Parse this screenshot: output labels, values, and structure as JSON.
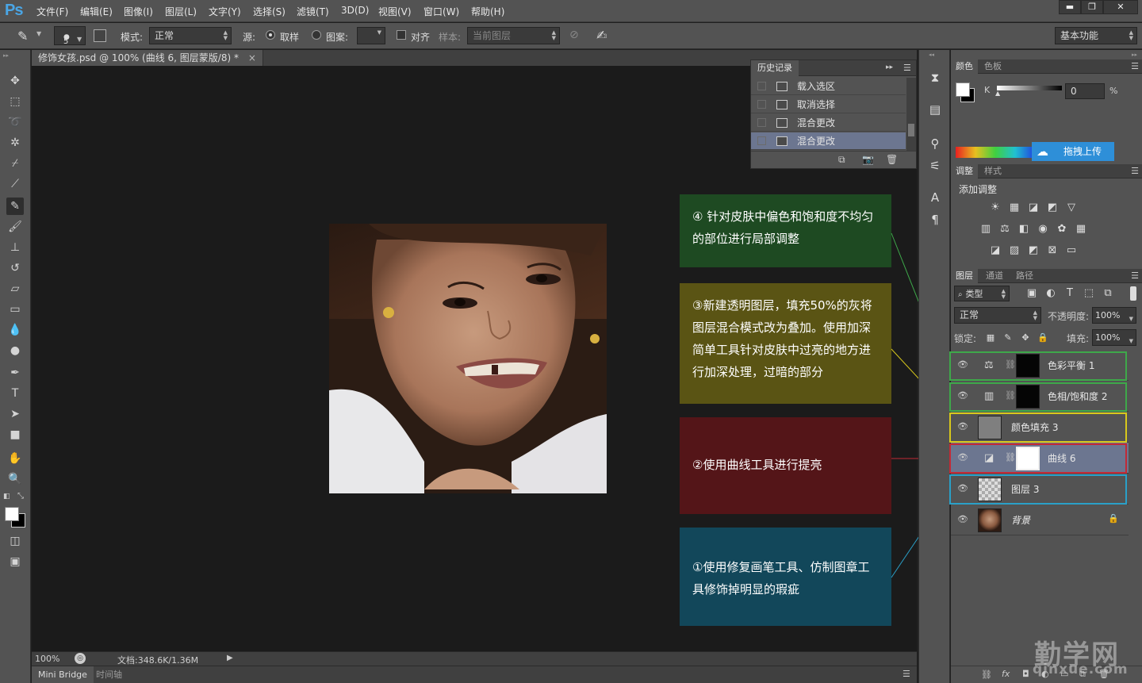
{
  "app": {
    "logo": "Ps"
  },
  "menu": [
    "文件(F)",
    "编辑(E)",
    "图像(I)",
    "图层(L)",
    "文字(Y)",
    "选择(S)",
    "滤镜(T)",
    "3D(D)",
    "视图(V)",
    "窗口(W)",
    "帮助(H)"
  ],
  "window_controls": {
    "minimize": "▬",
    "restore": "❐",
    "close": "✕"
  },
  "options": {
    "brush_size": "5",
    "mode_label": "模式:",
    "mode_value": "正常",
    "source_label": "源:",
    "sampled_label": "取样",
    "pattern_label": "图案:",
    "aligned_label": "对齐",
    "sample_label": "样本:",
    "sample_value": "当前图层",
    "workspace": "基本功能"
  },
  "document": {
    "tab_title": "修饰女孩.psd @ 100% (曲线 6, 图层蒙版/8) *",
    "tab_close": "×",
    "zoom": "100%",
    "doc_info": "文档:348.6K/1.36M"
  },
  "bottom_tabs": [
    "Mini Bridge",
    "时间轴"
  ],
  "history": {
    "title": "历史记录",
    "items": [
      "载入选区",
      "取消选择",
      "混合更改",
      "混合更改"
    ],
    "selected_index": 3
  },
  "notes": [
    {
      "text": "④ 针对皮肤中偏色和饱和度不均匀的部位进行局部调整",
      "color": "#1e4a22"
    },
    {
      "text": "③新建透明图层，填充50%的灰将图层混合模式改为叠加。使用加深简单工具针对皮肤中过亮的地方进行加深处理，过暗的部分",
      "color": "#5a5414"
    },
    {
      "text": "②使用曲线工具进行提亮",
      "color": "#541518"
    },
    {
      "text": "①使用修复画笔工具、仿制图章工具修饰掉明显的瑕疵",
      "color": "#12475a"
    }
  ],
  "color_panel": {
    "tabs": [
      "颜色",
      "色板"
    ],
    "channel_label": "K",
    "k_value": "0",
    "unit": "%",
    "upload_label": "拖拽上传"
  },
  "adjust_panel": {
    "tabs": [
      "调整",
      "样式"
    ],
    "heading": "添加调整"
  },
  "layers_panel": {
    "tabs": [
      "图层",
      "通道",
      "路径"
    ],
    "filter_label": "类型",
    "blend_mode": "正常",
    "opacity_label": "不透明度:",
    "opacity_value": "100%",
    "lock_label": "锁定:",
    "fill_label": "填充:",
    "fill_value": "100%",
    "layers": [
      {
        "name": "色彩平衡 1",
        "outline": "#3ea84a"
      },
      {
        "name": "色相/饱和度 2",
        "outline": "#3ea84a"
      },
      {
        "name": "颜色填充 3",
        "outline": "#d8c81c"
      },
      {
        "name": "曲线 6",
        "outline": "#c22a36",
        "selected": true
      },
      {
        "name": "图层 3",
        "outline": "#2aa0c8"
      },
      {
        "name": "背景"
      }
    ]
  },
  "watermark": {
    "title": "勤学网",
    "url": "qinxue.com"
  }
}
